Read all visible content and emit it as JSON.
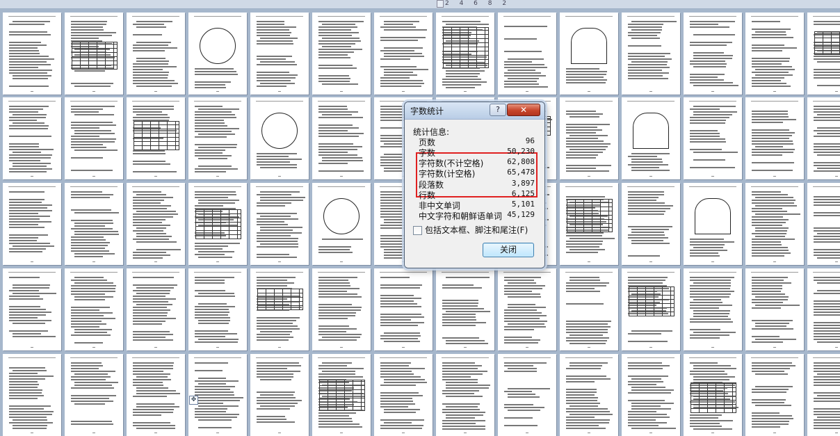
{
  "ruler": {
    "marks": "2 4 6 8 2"
  },
  "dialog": {
    "title": "字数统计",
    "help_label": "?",
    "close_glyph": "✕",
    "section_label": "统计信息:",
    "stats": [
      {
        "label": "页数",
        "value": "96"
      },
      {
        "label": "字数",
        "value": "50,230"
      },
      {
        "label": "字符数(不计空格)",
        "value": "62,808"
      },
      {
        "label": "字符数(计空格)",
        "value": "65,478"
      },
      {
        "label": "段落数",
        "value": "3,897"
      },
      {
        "label": "行数",
        "value": "6,125"
      },
      {
        "label": "非中文单词",
        "value": "5,101"
      },
      {
        "label": "中文字符和朝鲜语单词",
        "value": "45,129"
      }
    ],
    "checkbox_label": "包括文本框、脚注和尾注(F)",
    "checkbox_checked": false,
    "close_button_label": "关闭",
    "highlight_color": "#e02020"
  },
  "document": {
    "visible_page_thumbnails": 70
  },
  "icons": {
    "move_handle": "move-icon"
  }
}
